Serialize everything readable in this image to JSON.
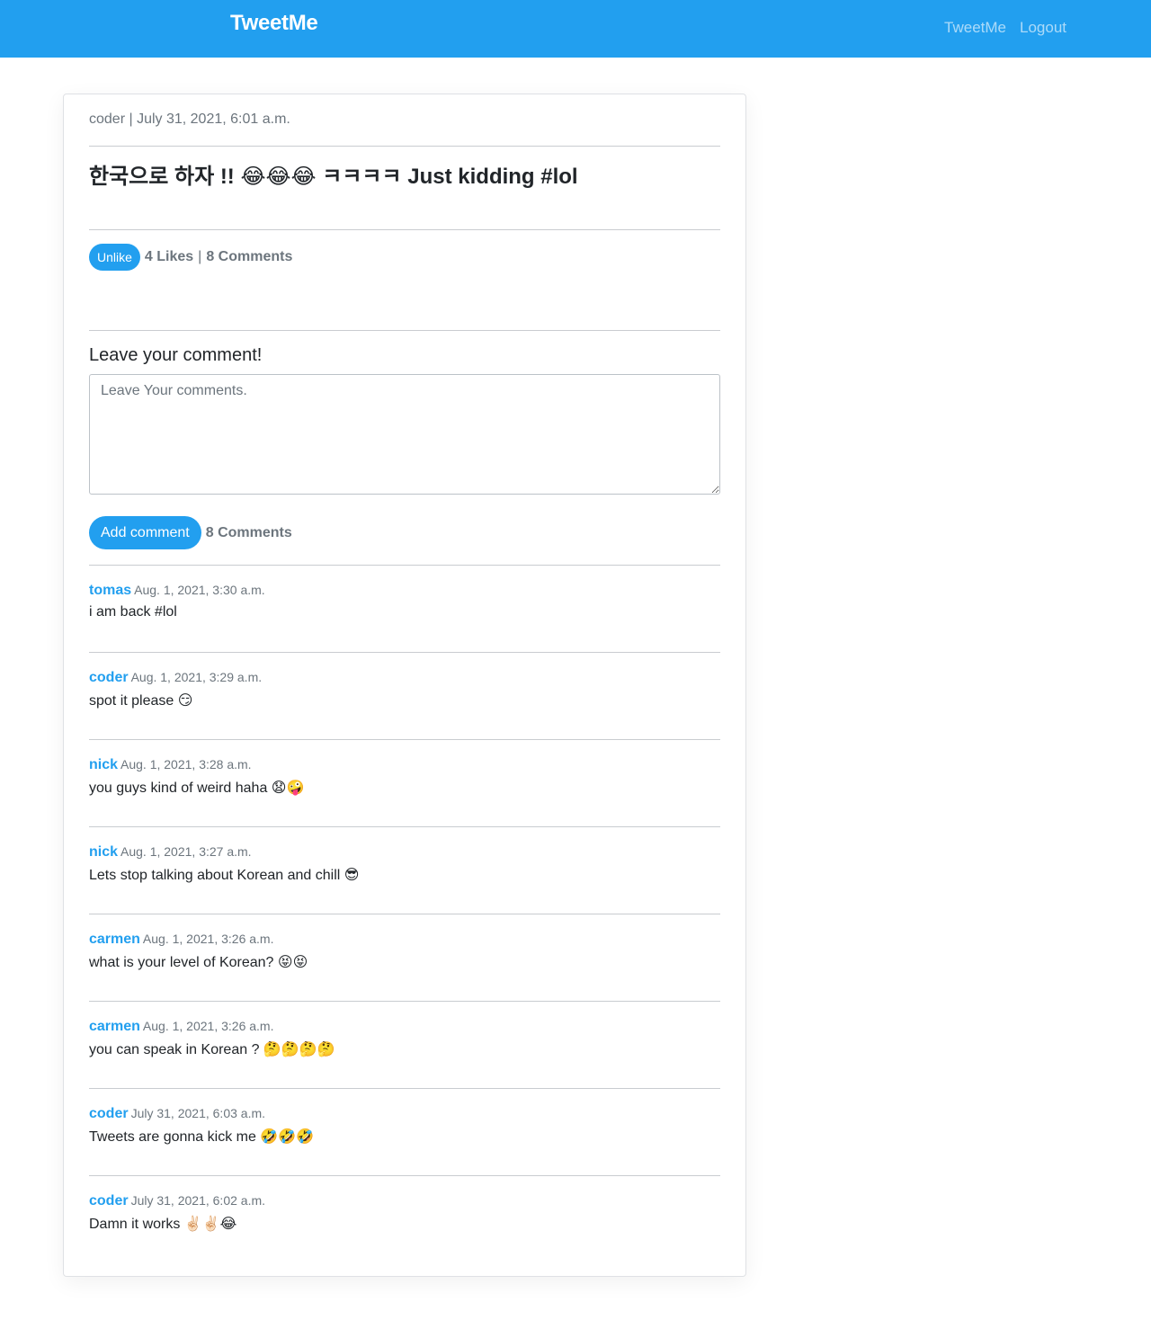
{
  "navbar": {
    "brand": "TweetMe",
    "links": [
      "TweetMe",
      "Logout"
    ]
  },
  "tweet": {
    "meta": "coder | July 31, 2021, 6:01 a.m.",
    "content": "한국으로 하자 !! 😂😂😂 ㅋㅋㅋㅋ Just kidding #lol",
    "unlike_label": "Unlike",
    "likes": "4 Likes",
    "separator": "|",
    "comments_count": "8 Comments"
  },
  "comment_form": {
    "title": "Leave your comment!",
    "placeholder": "Leave Your comments.",
    "value": "",
    "submit_label": "Add comment",
    "comments_count": "8 Comments"
  },
  "comments": [
    {
      "user": "tomas",
      "date": "Aug. 1, 2021, 3:30 a.m.",
      "text": "i am back #lol"
    },
    {
      "user": "coder",
      "date": "Aug. 1, 2021, 3:29 a.m.",
      "text": "spot it please 😏"
    },
    {
      "user": "nick",
      "date": "Aug. 1, 2021, 3:28 a.m.",
      "text": "you guys kind of weird haha 😧🤪"
    },
    {
      "user": "nick",
      "date": "Aug. 1, 2021, 3:27 a.m.",
      "text": "Lets stop talking about Korean and chill 😎"
    },
    {
      "user": "carmen",
      "date": "Aug. 1, 2021, 3:26 a.m.",
      "text": "what is your level of Korean? 😝😝"
    },
    {
      "user": "carmen",
      "date": "Aug. 1, 2021, 3:26 a.m.",
      "text": "you can speak in Korean ? 🤔🤔🤔🤔"
    },
    {
      "user": "coder",
      "date": "July 31, 2021, 6:03 a.m.",
      "text": "Tweets are gonna kick me 🤣🤣🤣"
    },
    {
      "user": "coder",
      "date": "July 31, 2021, 6:02 a.m.",
      "text": "Damn it works ✌🏻✌🏻😂"
    }
  ]
}
